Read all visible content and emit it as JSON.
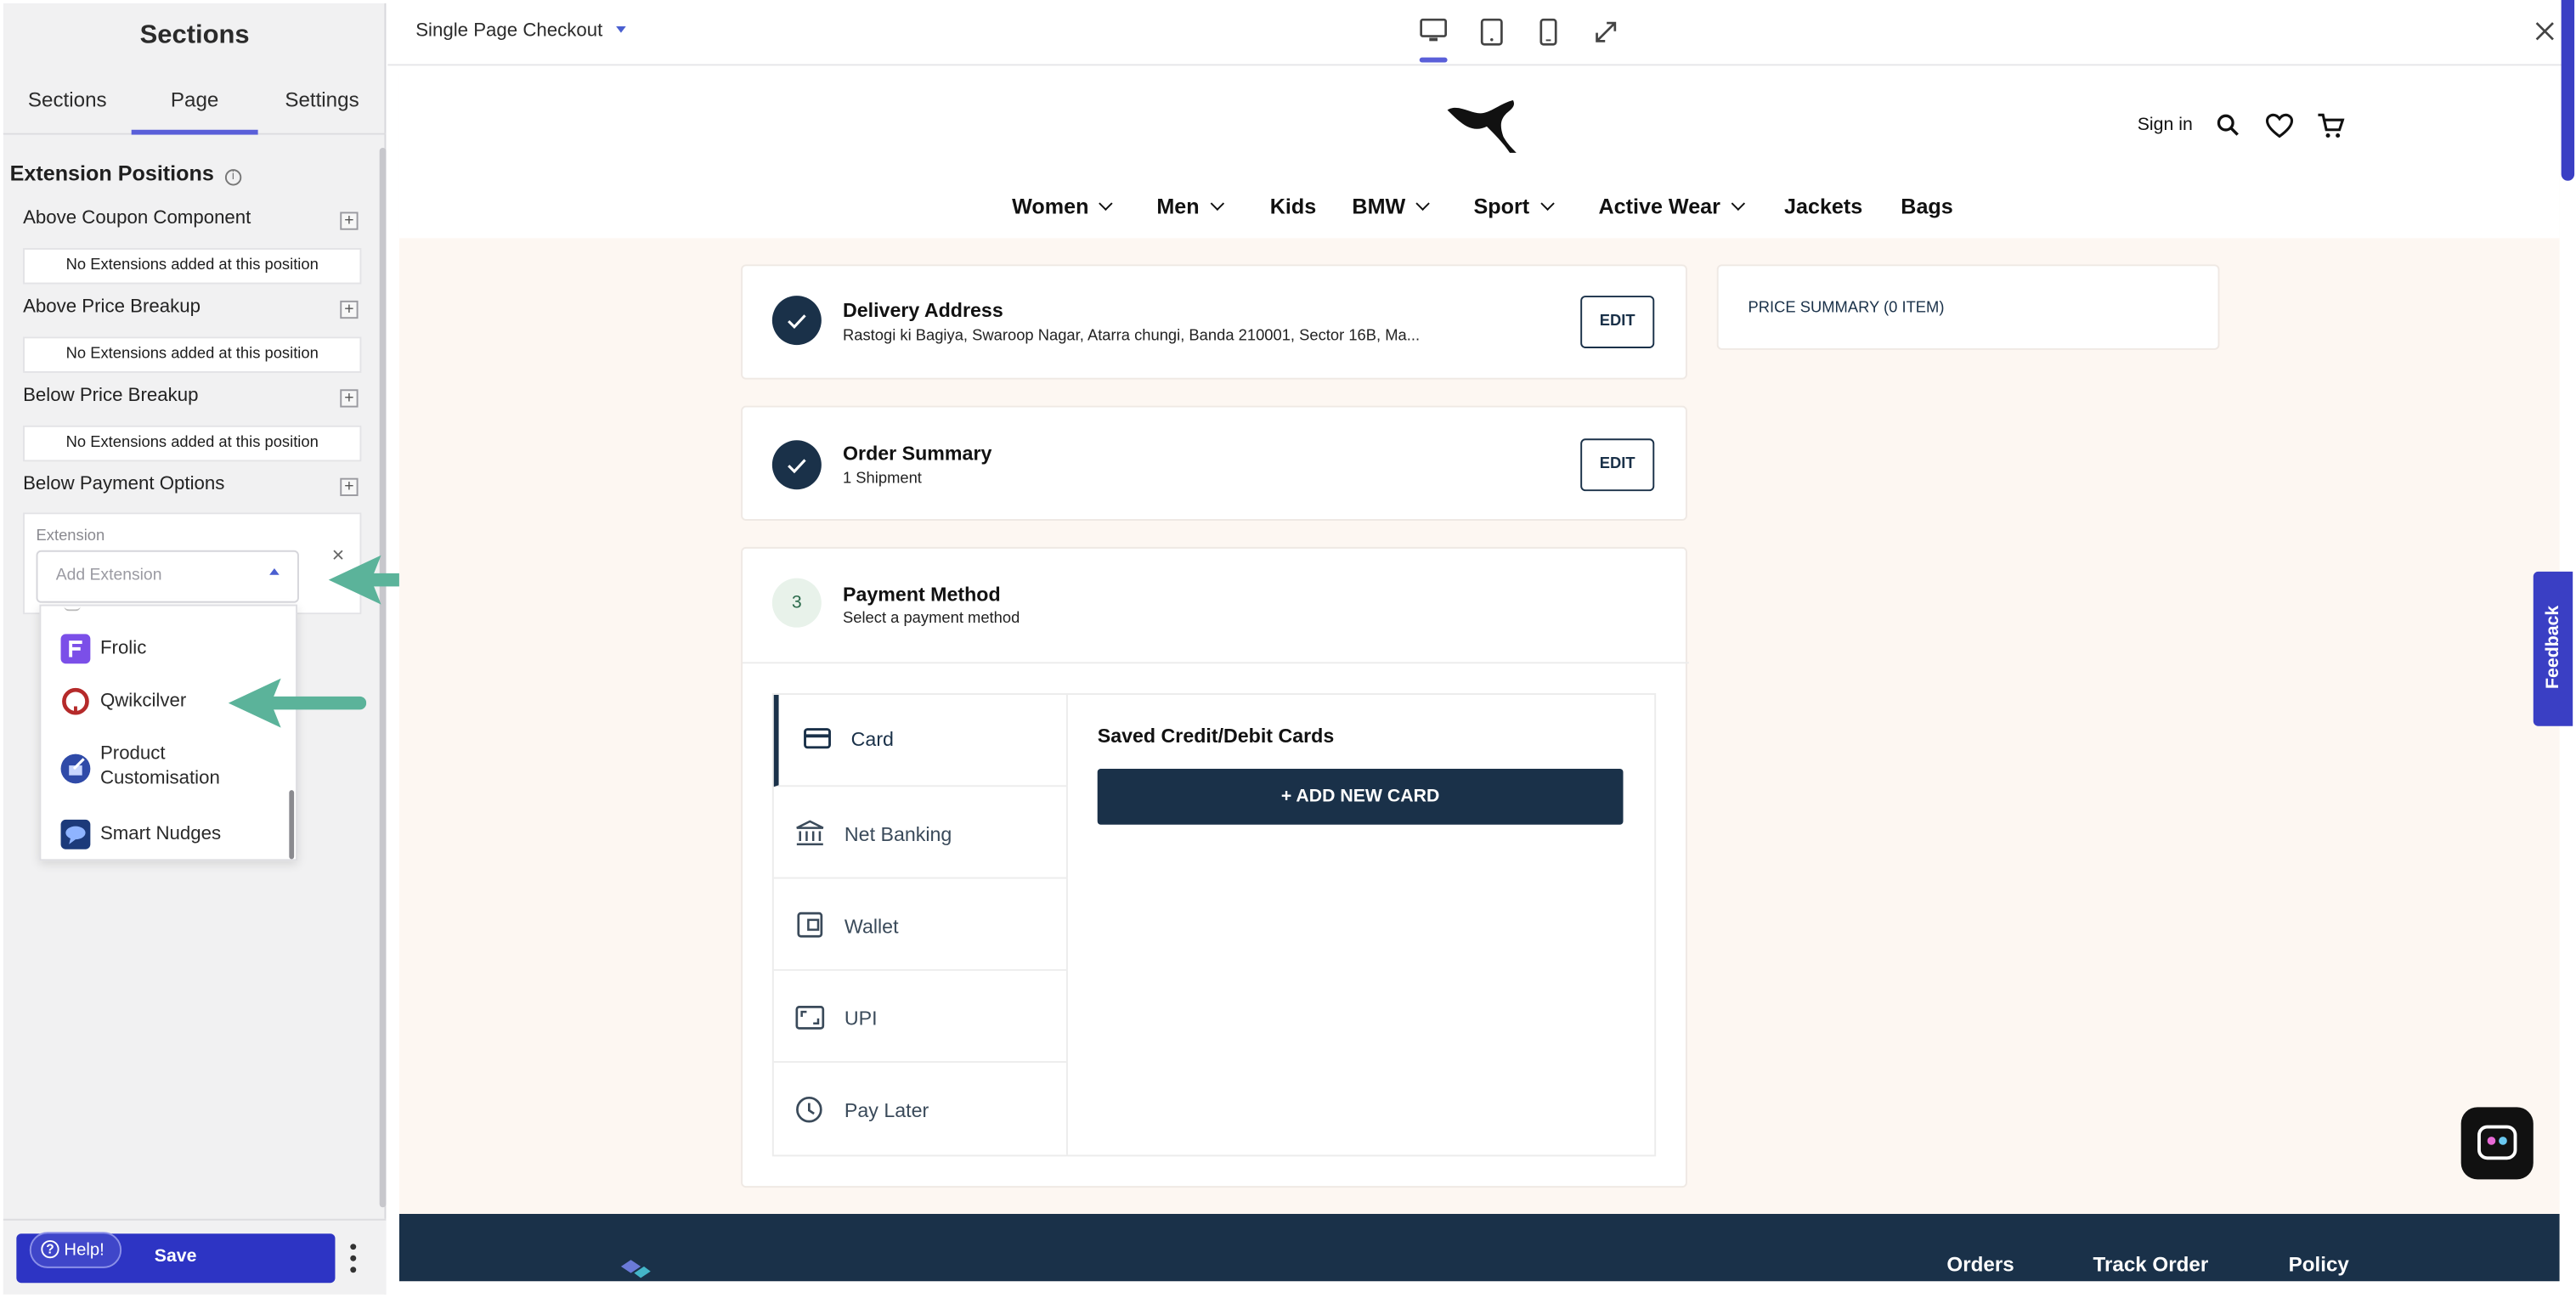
{
  "left_panel": {
    "title": "Sections",
    "tabs": [
      {
        "label": "Sections"
      },
      {
        "label": "Page"
      },
      {
        "label": "Settings"
      }
    ],
    "section_heading": "Extension Positions",
    "positions": [
      {
        "label": "Above Coupon Component",
        "empty_text": "No Extensions added at this position"
      },
      {
        "label": "Above Price Breakup",
        "empty_text": "No Extensions added at this position"
      },
      {
        "label": "Below Price Breakup",
        "empty_text": "No Extensions added at this position"
      },
      {
        "label": "Below Payment Options"
      }
    ],
    "extension_field": {
      "label": "Extension",
      "placeholder": "Add Extension"
    },
    "dropdown_options": [
      {
        "label": "Frolic",
        "icon": "frolic-icon",
        "color": "#7b4fe8"
      },
      {
        "label": "Qwikcilver",
        "icon": "qwikcilver-icon",
        "color": "#b52a2a"
      },
      {
        "label": "Product Customisation",
        "icon": "product-customisation-icon",
        "color": "#2f4aa8"
      },
      {
        "label": "Smart Nudges",
        "icon": "smart-nudges-icon",
        "color": "#1c3a7a"
      }
    ],
    "help_label": "Help!",
    "save_label": "Save"
  },
  "topbar": {
    "page_selector": "Single Page Checkout",
    "devices": [
      "desktop-icon",
      "tablet-icon",
      "mobile-icon",
      "fullscreen-icon"
    ]
  },
  "site": {
    "sign_in": "Sign in",
    "nav": [
      "Women",
      "Men",
      "Kids",
      "BMW",
      "Sport",
      "Active Wear",
      "Jackets",
      "Bags"
    ]
  },
  "checkout": {
    "delivery": {
      "title": "Delivery Address",
      "subtitle": "Rastogi ki Bagiya, Swaroop Nagar, Atarra chungi, Banda 210001, Sector 16B, Ma...",
      "edit": "EDIT"
    },
    "order_summary": {
      "title": "Order Summary",
      "subtitle": "1 Shipment",
      "edit": "EDIT"
    },
    "payment": {
      "step": "3",
      "title": "Payment Method",
      "subtitle": "Select a payment method",
      "methods": [
        "Card",
        "Net Banking",
        "Wallet",
        "UPI",
        "Pay Later"
      ],
      "saved_cards_title": "Saved Credit/Debit Cards",
      "add_card": "+ ADD NEW CARD"
    },
    "price_summary": "PRICE SUMMARY (0 ITEM)"
  },
  "feedback_tab": "Feedback",
  "footer": {
    "links": [
      "Orders",
      "Track Order",
      "Policy"
    ]
  },
  "colors": {
    "accent": "#5a5fd9",
    "save_button": "#2d34c4",
    "navy": "#1a3149",
    "annotation_arrow": "#5bb39a",
    "canvas_bg": "#fdf7f2"
  }
}
